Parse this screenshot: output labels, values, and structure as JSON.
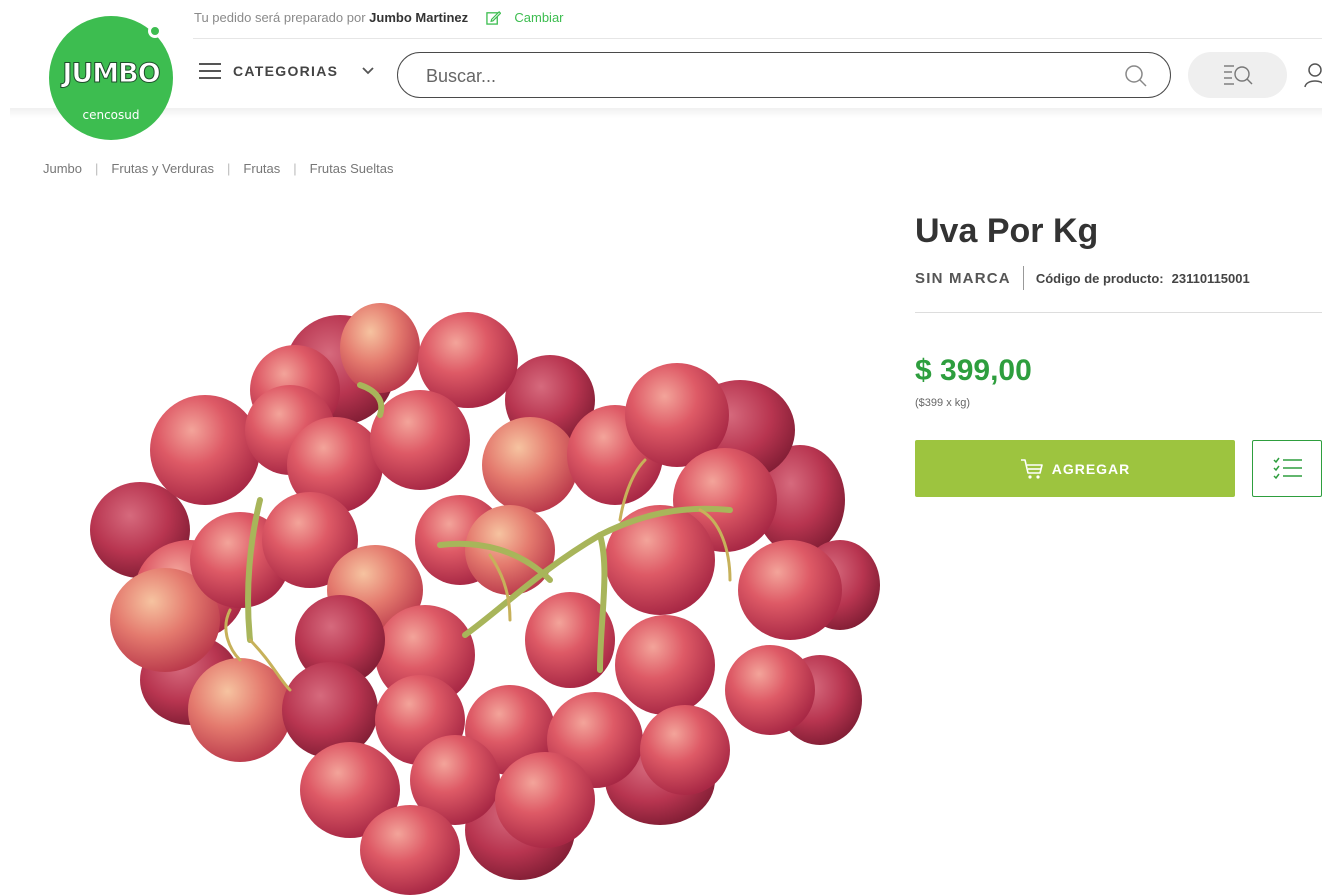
{
  "header": {
    "logo_text": "JUMBO",
    "logo_subtext": "cencosud",
    "prepared_by_prefix": "Tu pedido será preparado por",
    "store_name": "Jumbo Martinez",
    "change_label": "Cambiar",
    "categories_label": "CATEGORIAS",
    "search_placeholder": "Buscar..."
  },
  "breadcrumb": [
    "Jumbo",
    "Frutas y Verduras",
    "Frutas",
    "Frutas Sueltas"
  ],
  "product": {
    "title": "Uva Por Kg",
    "brand": "SIN MARCA",
    "code_label": "Código de producto:",
    "code_value": "23110115001",
    "price": "$ 399,00",
    "unit_price": "($399 x kg)",
    "add_label": "AGREGAR",
    "image_icon": "red-grapes-bunch"
  },
  "colors": {
    "brand_green": "#3dbd50",
    "price_green": "#2e9e3e",
    "add_button": "#9dc43f",
    "grape_red": "#d8505c"
  }
}
